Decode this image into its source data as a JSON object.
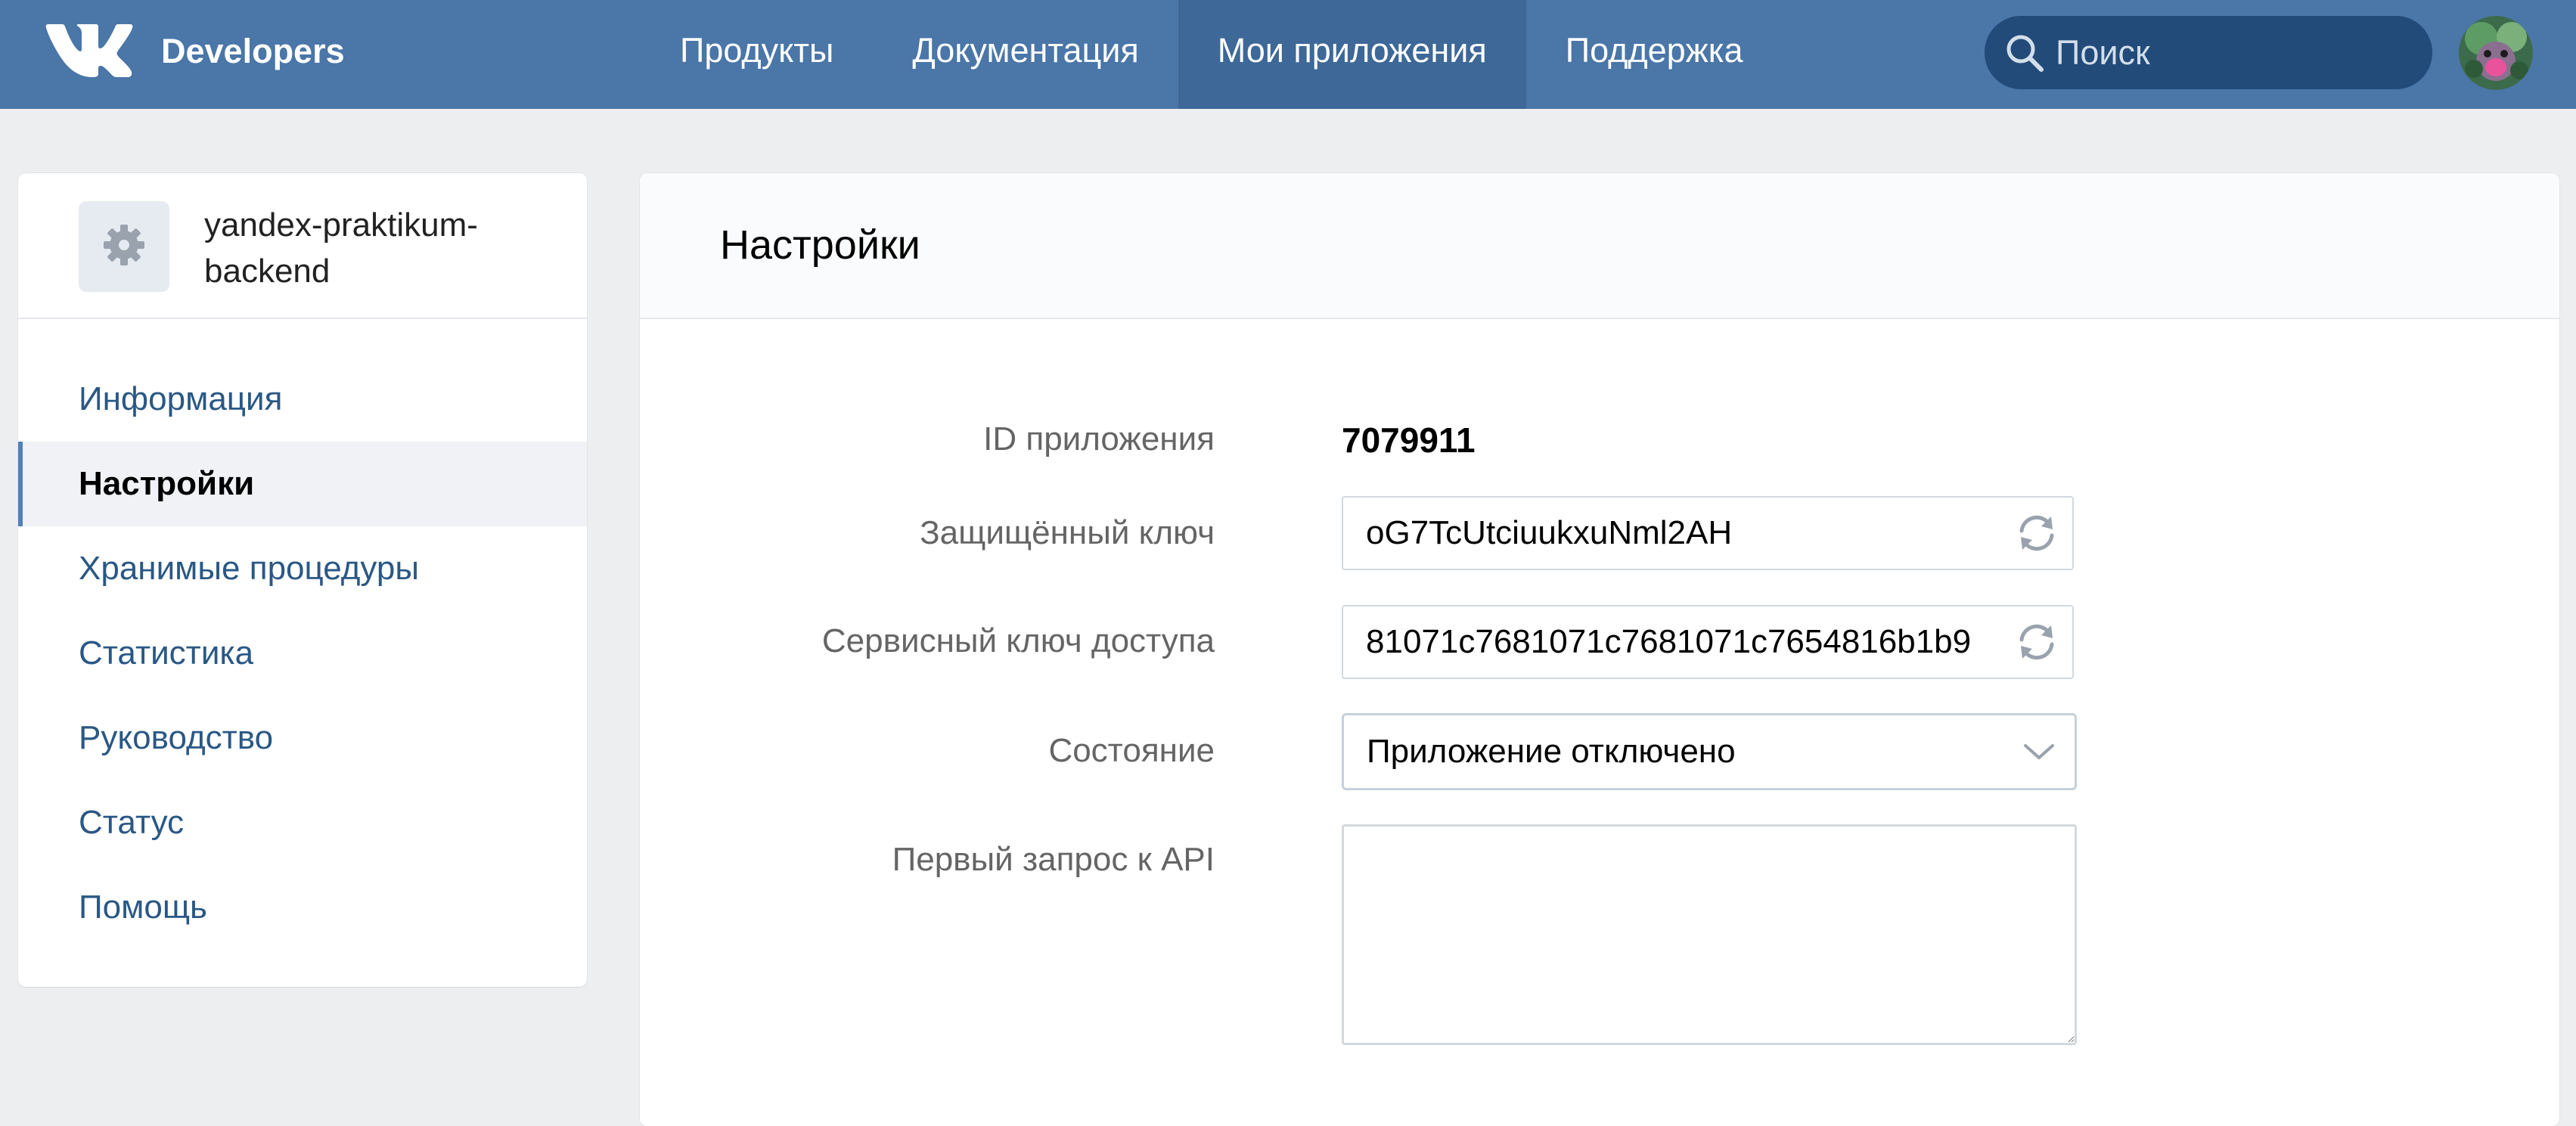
{
  "header": {
    "brand": "Developers",
    "nav": [
      {
        "label": "Продукты",
        "active": false
      },
      {
        "label": "Документация",
        "active": false
      },
      {
        "label": "Мои приложения",
        "active": true
      },
      {
        "label": "Поддержка",
        "active": false
      }
    ],
    "search": {
      "placeholder": "Поиск",
      "value": ""
    },
    "colors": {
      "bar": "#4a76a8",
      "active_tab": "#3d6898",
      "search_bg": "#224b7a"
    }
  },
  "sidebar": {
    "app_name": "yandex-praktikum-backend",
    "app_icon": "gear-icon",
    "items": [
      {
        "label": "Информация",
        "active": false
      },
      {
        "label": "Настройки",
        "active": true
      },
      {
        "label": "Хранимые процедуры",
        "active": false
      },
      {
        "label": "Статистика",
        "active": false
      },
      {
        "label": "Руководство",
        "active": false
      },
      {
        "label": "Статус",
        "active": false
      },
      {
        "label": "Помощь",
        "active": false
      }
    ]
  },
  "main": {
    "title": "Настройки",
    "form": {
      "app_id": {
        "label": "ID приложения",
        "value": "7079911"
      },
      "secure_key": {
        "label": "Защищённый ключ",
        "value": "oG7TcUtciuukxuNml2AH",
        "icon": "refresh-icon"
      },
      "service_key": {
        "label": "Сервисный ключ доступа",
        "value": "81071c7681071c7681071c7654816b1b9",
        "icon": "refresh-icon"
      },
      "state": {
        "label": "Состояние",
        "value": "Приложение отключено",
        "icon": "chevron-down-icon"
      },
      "first_request": {
        "label": "Первый запрос к API",
        "value": ""
      }
    }
  }
}
